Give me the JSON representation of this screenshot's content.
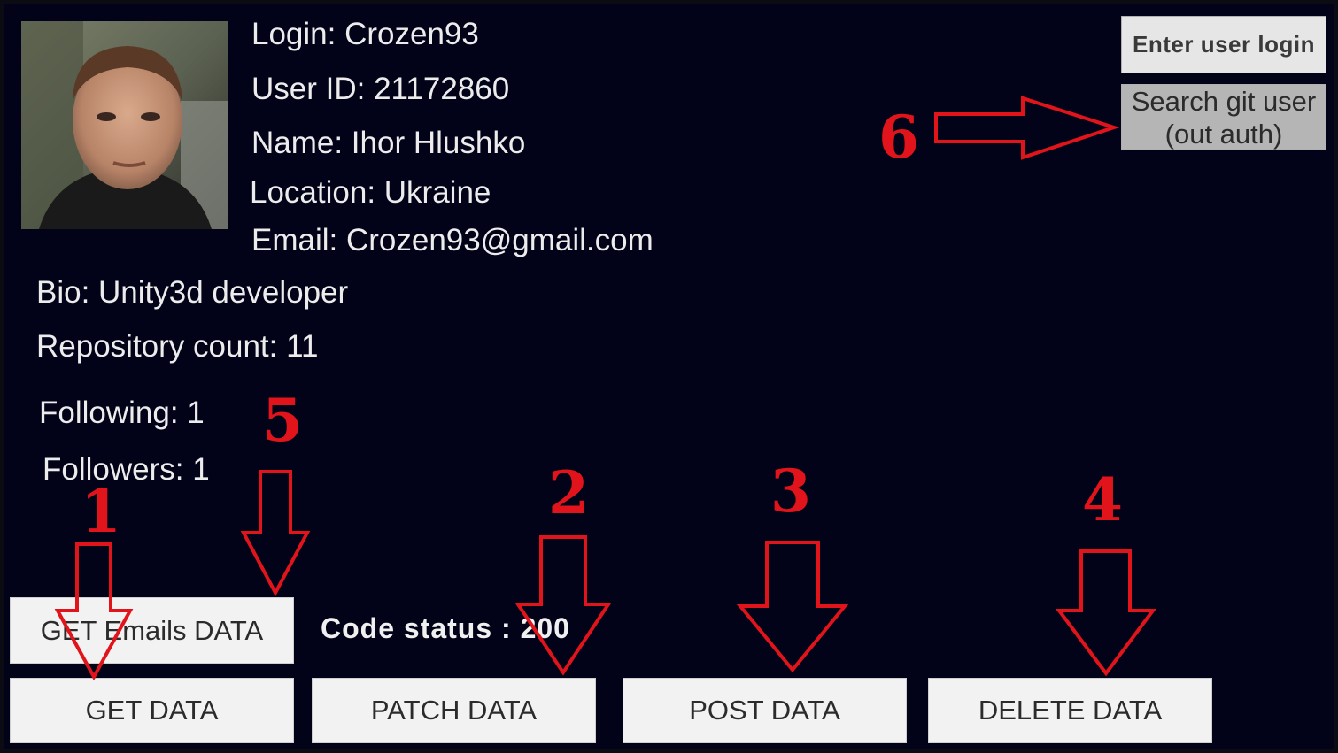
{
  "profile": {
    "login": "Login: Crozen93",
    "user_id": "User ID: 21172860",
    "name": "Name: Ihor Hlushko",
    "location": "Location: Ukraine",
    "email": "Email: Crozen93@gmail.com",
    "bio": "Bio: Unity3d developer",
    "repository_count": "Repository count: 11",
    "following": "Following: 1",
    "followers": "Followers: 1"
  },
  "search": {
    "login_placeholder": "Enter user login",
    "search_line1": "Search git user",
    "search_line2": "(out auth)"
  },
  "buttons": {
    "get_emails": "GET Emails DATA",
    "get": "GET DATA",
    "patch": "PATCH DATA",
    "post": "POST DATA",
    "delete": "DELETE DATA"
  },
  "status": "Code status : 200",
  "annotations": {
    "n1": "1",
    "n2": "2",
    "n3": "3",
    "n4": "4",
    "n5": "5",
    "n6": "6"
  },
  "colors": {
    "background": "#020218",
    "annotation": "#e0141a",
    "button": "#f2f2f2"
  }
}
